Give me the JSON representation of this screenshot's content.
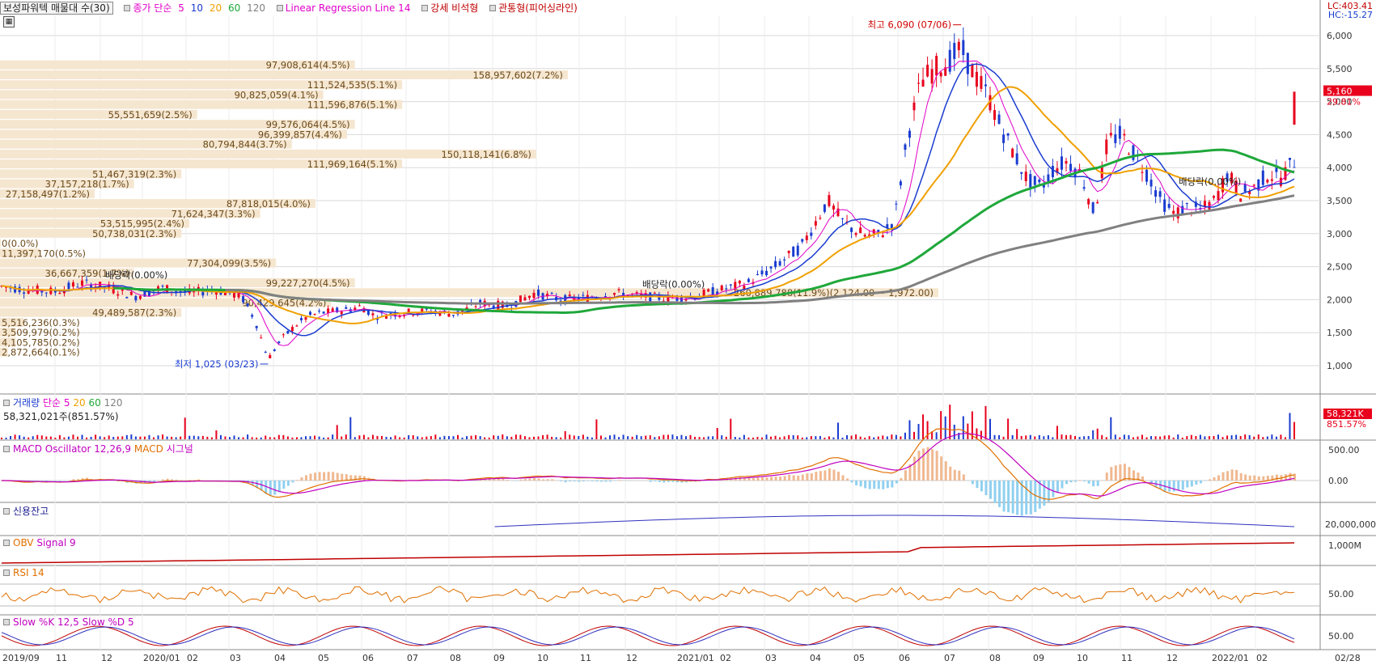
{
  "legend": {
    "main_label": "보성파워텍 매물대 수(30)",
    "ma_label": "종가 단순",
    "ma_periods": [
      "5",
      "10",
      "20",
      "60",
      "120"
    ],
    "ma_colors": [
      "#e000c8",
      "#1a3cd0",
      "#f0a000",
      "#1fa83a",
      "#808080"
    ],
    "lr_label": "Linear Regression Line 14",
    "lr_color": "#e000c8",
    "candle_label1": "강세 비석형",
    "candle_label2": "관통형(피어싱라인)",
    "candle_color": "#c00000"
  },
  "corner": {
    "lc": "LC:403.41",
    "hc": "HC:-15.27"
  },
  "colors": {
    "up": "#e8001c",
    "down": "#1a3cd0",
    "grid": "#d8d8d8",
    "band": "#f5e6d0",
    "band_text": "#6b4a1a",
    "axis_text": "#333"
  },
  "panels": {
    "volume": {
      "title": "거래량",
      "ma": "단순",
      "periods": [
        "5",
        "20",
        "60",
        "120"
      ],
      "value_text": "58,321,021주(851.57%)",
      "axis_badge": "58,321K",
      "axis_pct": "851.57%"
    },
    "macd": {
      "title": "MACD Oscillator 12,26,9",
      "macd": "MACD",
      "signal": "시그널",
      "ticks": [
        "500.00",
        "0.00"
      ]
    },
    "credit": {
      "title": "신용잔고",
      "ticks": [
        "20,000,000"
      ]
    },
    "obv": {
      "title": "OBV",
      "signal": "Signal 9",
      "ticks": [
        "1,000M"
      ]
    },
    "rsi": {
      "title": "RSI 14",
      "ticks": [
        "50.00"
      ]
    },
    "stoch": {
      "title": "Slow %K 12,5",
      "d": "Slow %D 5",
      "ticks": [
        "50.00"
      ]
    }
  },
  "annotations": {
    "high": "최고 6,090 (07/06)",
    "low": "최저 1,025 (03/23)",
    "div1": "배당락(0.00%)",
    "div2": "배당락(0.00%)",
    "div3": "배당락(0.00%)",
    "last_price": "5,160",
    "last_pct": "29.81%"
  },
  "chart_data": {
    "type": "candlestick",
    "price_axis": {
      "ticks": [
        1000,
        1500,
        2000,
        2500,
        3000,
        3500,
        4000,
        4500,
        5000,
        5500,
        6000
      ],
      "labels": [
        "1,000",
        "1,500",
        "2,000",
        "2,500",
        "3,000",
        "3,500",
        "4,000",
        "4,500",
        "5,000",
        "5,500",
        "6,000"
      ]
    },
    "x_axis": {
      "labels": [
        "2019/09",
        "11",
        "12",
        "2020/01",
        "02",
        "03",
        "04",
        "05",
        "06",
        "07",
        "08",
        "09",
        "10",
        "11",
        "12",
        "2021/01",
        "02",
        "03",
        "04",
        "05",
        "06",
        "07",
        "08",
        "09",
        "10",
        "11",
        "12",
        "2022/01",
        "02"
      ],
      "last_label": "02/28"
    },
    "price_path": [
      [
        0,
        2200
      ],
      [
        2,
        2150
      ],
      [
        4,
        2120
      ],
      [
        6,
        2250
      ],
      [
        8,
        2180
      ],
      [
        10,
        2050
      ],
      [
        12,
        2180
      ],
      [
        14,
        2100
      ],
      [
        16,
        2150
      ],
      [
        18,
        2050
      ],
      [
        19,
        1700
      ],
      [
        20,
        1100
      ],
      [
        21,
        1400
      ],
      [
        22,
        1600
      ],
      [
        23,
        1750
      ],
      [
        24,
        1800
      ],
      [
        26,
        1850
      ],
      [
        27,
        1900
      ],
      [
        28,
        1750
      ],
      [
        30,
        1800
      ],
      [
        32,
        1830
      ],
      [
        34,
        1780
      ],
      [
        36,
        1950
      ],
      [
        38,
        1900
      ],
      [
        40,
        2100
      ],
      [
        42,
        2000
      ],
      [
        44,
        2030
      ],
      [
        46,
        2100
      ],
      [
        48,
        2050
      ],
      [
        50,
        2020
      ],
      [
        52,
        2050
      ],
      [
        54,
        2150
      ],
      [
        56,
        2250
      ],
      [
        58,
        2500
      ],
      [
        60,
        2800
      ],
      [
        62,
        3500
      ],
      [
        63,
        3200
      ],
      [
        64,
        3050
      ],
      [
        65,
        2950
      ],
      [
        66,
        3000
      ],
      [
        67,
        3200
      ],
      [
        68,
        4500
      ],
      [
        69,
        5300
      ],
      [
        70,
        5500
      ],
      [
        71,
        5600
      ],
      [
        72,
        5800
      ],
      [
        73,
        5400
      ],
      [
        74,
        5100
      ],
      [
        75,
        4600
      ],
      [
        76,
        4200
      ],
      [
        77,
        3800
      ],
      [
        78,
        3700
      ],
      [
        79,
        4000
      ],
      [
        80,
        4100
      ],
      [
        81,
        3900
      ],
      [
        82,
        3300
      ],
      [
        83,
        4400
      ],
      [
        84,
        4500
      ],
      [
        85,
        4200
      ],
      [
        86,
        3900
      ],
      [
        87,
        3500
      ],
      [
        88,
        3300
      ],
      [
        89,
        3400
      ],
      [
        90,
        3350
      ],
      [
        91,
        3500
      ],
      [
        92,
        3900
      ],
      [
        93,
        3600
      ],
      [
        94,
        3700
      ],
      [
        95,
        3900
      ],
      [
        96,
        3850
      ],
      [
        97,
        4100
      ]
    ],
    "volume_profile": [
      {
        "price": 5550,
        "label": "97,908,614(4.5%)",
        "pct": 4.5
      },
      {
        "price": 5400,
        "label": "158,957,602(7.2%)",
        "pct": 7.2
      },
      {
        "price": 5250,
        "label": "111,524,535(5.1%)",
        "pct": 5.1
      },
      {
        "price": 5100,
        "label": "90,825,059(4.1%)",
        "pct": 4.1
      },
      {
        "price": 4950,
        "label": "111,596,876(5.1%)",
        "pct": 5.1
      },
      {
        "price": 4800,
        "label": "55,551,659(2.5%)",
        "pct": 2.5
      },
      {
        "price": 4650,
        "label": "99,576,064(4.5%)",
        "pct": 4.5
      },
      {
        "price": 4500,
        "label": "96,399,857(4.4%)",
        "pct": 4.4
      },
      {
        "price": 4350,
        "label": "80,794,844(3.7%)",
        "pct": 3.7
      },
      {
        "price": 4200,
        "label": "150,118,141(6.8%)",
        "pct": 6.8
      },
      {
        "price": 4050,
        "label": "111,969,164(5.1%)",
        "pct": 5.1
      },
      {
        "price": 3900,
        "label": "51,467,319(2.3%)",
        "pct": 2.3
      },
      {
        "price": 3750,
        "label": "37,157,218(1.7%)",
        "pct": 1.7
      },
      {
        "price": 3600,
        "label": "27,158,497(1.2%)",
        "pct": 1.2
      },
      {
        "price": 3450,
        "label": "87,818,015(4.0%)",
        "pct": 4.0
      },
      {
        "price": 3300,
        "label": "71,624,347(3.3%)",
        "pct": 3.3
      },
      {
        "price": 3150,
        "label": "53,515,995(2.4%)",
        "pct": 2.4
      },
      {
        "price": 3000,
        "label": "50,738,031(2.3%)",
        "pct": 2.3
      },
      {
        "price": 2850,
        "label": "0(0.0%)",
        "pct": 0
      },
      {
        "price": 2700,
        "label": "11,397,170(0.5%)",
        "pct": 0.5
      },
      {
        "price": 2550,
        "label": "77,304,099(3.5%)",
        "pct": 3.5
      },
      {
        "price": 2400,
        "label": "36,667,359(1.7%)",
        "pct": 1.7
      },
      {
        "price": 2250,
        "label": "99,227,270(4.5%)",
        "pct": 4.5
      },
      {
        "price": 2100,
        "label": "260,889,788(11.9%)(2,124.00 ~ 1,972.00)",
        "pct": 11.9
      },
      {
        "price": 1950,
        "label": "90,429,645(4.2%)",
        "pct": 4.2
      },
      {
        "price": 1800,
        "label": "49,489,587(2.3%)",
        "pct": 2.3
      },
      {
        "price": 1650,
        "label": "5,516,236(0.3%)",
        "pct": 0.3
      },
      {
        "price": 1500,
        "label": "3,509,979(0.2%)",
        "pct": 0.2
      },
      {
        "price": 1350,
        "label": "4,105,785(0.2%)",
        "pct": 0.2
      },
      {
        "price": 1200,
        "label": "2,872,664(0.1%)",
        "pct": 0.1
      }
    ]
  }
}
